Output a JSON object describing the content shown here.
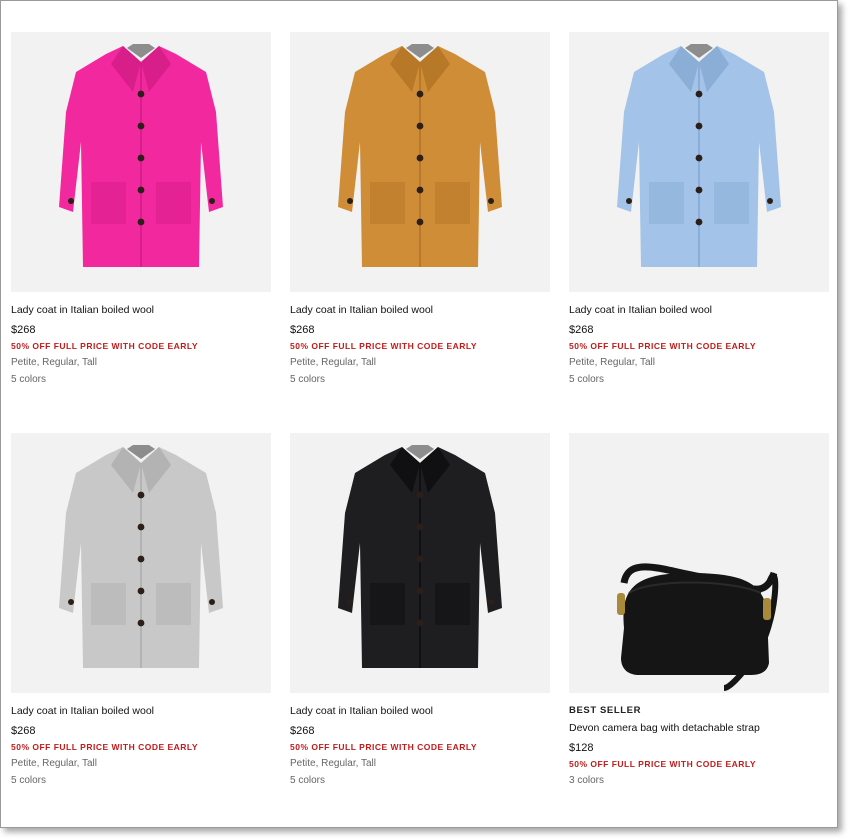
{
  "products": [
    {
      "badge": "",
      "name": "Lady coat in Italian boiled wool",
      "price": "$268",
      "promo": "50% OFF FULL PRICE WITH CODE EARLY",
      "fits": "Petite, Regular, Tall",
      "colors": "5 colors",
      "image": "pink-coat",
      "main_color": "#f2289f",
      "shade_color": "#d81e89"
    },
    {
      "badge": "",
      "name": "Lady coat in Italian boiled wool",
      "price": "$268",
      "promo": "50% OFF FULL PRICE WITH CODE EARLY",
      "fits": "Petite, Regular, Tall",
      "colors": "5 colors",
      "image": "camel-coat",
      "main_color": "#cf8d37",
      "shade_color": "#b77828"
    },
    {
      "badge": "",
      "name": "Lady coat in Italian boiled wool",
      "price": "$268",
      "promo": "50% OFF FULL PRICE WITH CODE EARLY",
      "fits": "Petite, Regular, Tall",
      "colors": "5 colors",
      "image": "light-blue-coat",
      "main_color": "#a3c3e8",
      "shade_color": "#8aaed6"
    },
    {
      "badge": "",
      "name": "Lady coat in Italian boiled wool",
      "price": "$268",
      "promo": "50% OFF FULL PRICE WITH CODE EARLY",
      "fits": "Petite, Regular, Tall",
      "colors": "5 colors",
      "image": "heather-grey-coat",
      "main_color": "#c8c8c8",
      "shade_color": "#b3b3b3"
    },
    {
      "badge": "",
      "name": "Lady coat in Italian boiled wool",
      "price": "$268",
      "promo": "50% OFF FULL PRICE WITH CODE EARLY",
      "fits": "Petite, Regular, Tall",
      "colors": "5 colors",
      "image": "black-coat",
      "main_color": "#1e1e20",
      "shade_color": "#101012"
    },
    {
      "badge": "BEST SELLER",
      "name": "Devon camera bag with detachable strap",
      "price": "$128",
      "promo": "50% OFF FULL PRICE WITH CODE EARLY",
      "fits": "",
      "colors": "3 colors",
      "image": "black-camera-bag",
      "main_color": "#151515",
      "shade_color": "#2a2a2a"
    }
  ],
  "colors": {
    "promo_red": "#c41a1a",
    "image_bg": "#f2f2f2",
    "button_dark": "#2b2018"
  }
}
